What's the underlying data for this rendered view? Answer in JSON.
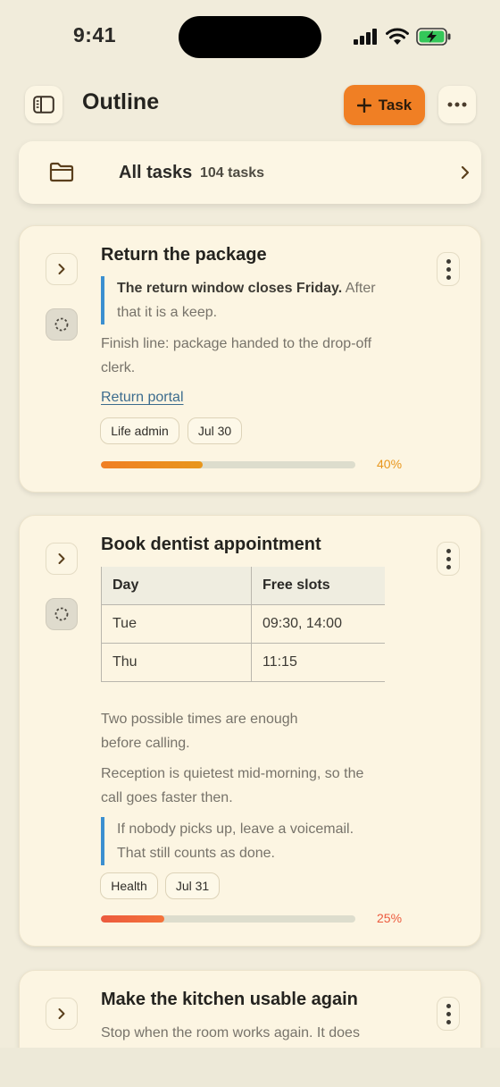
{
  "status_bar": {
    "time": "9:41"
  },
  "header": {
    "title": "Outline",
    "task_button_label": "Task"
  },
  "all_tasks": {
    "label": "All tasks",
    "count": "104 tasks"
  },
  "tasks": [
    {
      "title": "Return the package",
      "quote_bold": "The return window closes Friday.",
      "quote_rest": " After that it is a keep.",
      "note": "Finish line: package handed to the drop-off clerk.",
      "link": "Return portal",
      "tags": [
        "Life admin",
        "Jul 30"
      ],
      "progress": 0.4,
      "progress_label": "40%",
      "color": "#e8961c"
    },
    {
      "title": "Book dentist appointment",
      "table": {
        "headers": [
          "Day",
          "Free slots"
        ],
        "rows": [
          [
            "Tue",
            "09:30, 14:00"
          ],
          [
            "Thu",
            "11:15"
          ]
        ]
      },
      "paragraphs": [
        "Two possible times are enough before calling.",
        "Reception is quietest mid-morning, so the call goes faster then."
      ],
      "quote": "If nobody picks up, leave a voicemail. That still counts as done.",
      "tags": [
        "Health",
        "Jul 31"
      ],
      "progress": 0.25,
      "progress_label": "25%",
      "color": "#ec5a3e"
    },
    {
      "title": "Make the kitchen usable again",
      "note": "Stop when the room works again. It does"
    }
  ]
}
